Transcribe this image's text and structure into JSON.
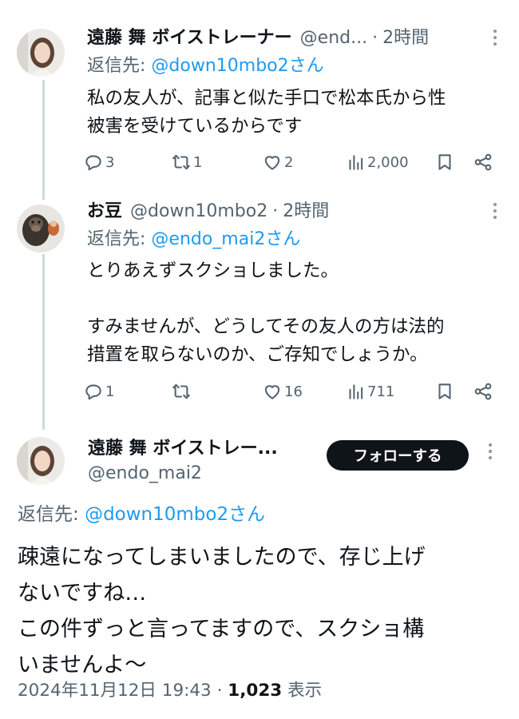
{
  "tweets": [
    {
      "name": "遠藤 舞 ボイストレーナー",
      "handle": "@end...",
      "separator": "·",
      "time": "2時間",
      "reply_label": "返信先: ",
      "reply_to": "@down10mbo2さん",
      "text": "私の友人が、記事と似た手口で松本氏から性\n被害を受けているからです",
      "replies": "3",
      "reposts": "1",
      "likes": "2",
      "views": "2,000",
      "avatar_icon": "woman-portrait-avatar"
    },
    {
      "name": "お豆",
      "handle": "@down10mbo2",
      "separator": "·",
      "time": "2時間",
      "reply_label": "返信先: ",
      "reply_to": "@endo_mai2さん",
      "text": "とりあえずスクショしました。\n\nすみませんが、どうしてその友人の方は法的\n措置を取らないのか、ご存知でしょうか。",
      "replies": "1",
      "reposts": "",
      "likes": "16",
      "views": "711",
      "avatar_icon": "gorilla-avatar"
    }
  ],
  "main_tweet": {
    "name": "遠藤 舞 ボイストレー...",
    "handle": "@endo_mai2",
    "follow_label": "フォローする",
    "reply_label": "返信先: ",
    "reply_to": "@down10mbo2さん",
    "text": "疎遠になってしまいましたので、存じ上げ\nないですね…\nこの件ずっと言ってますので、スクショ構\nいませんよ〜",
    "date": "2024年11月12日 19:43",
    "separator": "·",
    "views_count": "1,023",
    "views_label": "表示",
    "avatar_icon": "woman-portrait-avatar"
  },
  "colors": {
    "text": "#0f1419",
    "secondary": "#536471",
    "link": "#1d9bf0",
    "thread_line": "#cfd9de",
    "follow_button": "#0f1419"
  }
}
